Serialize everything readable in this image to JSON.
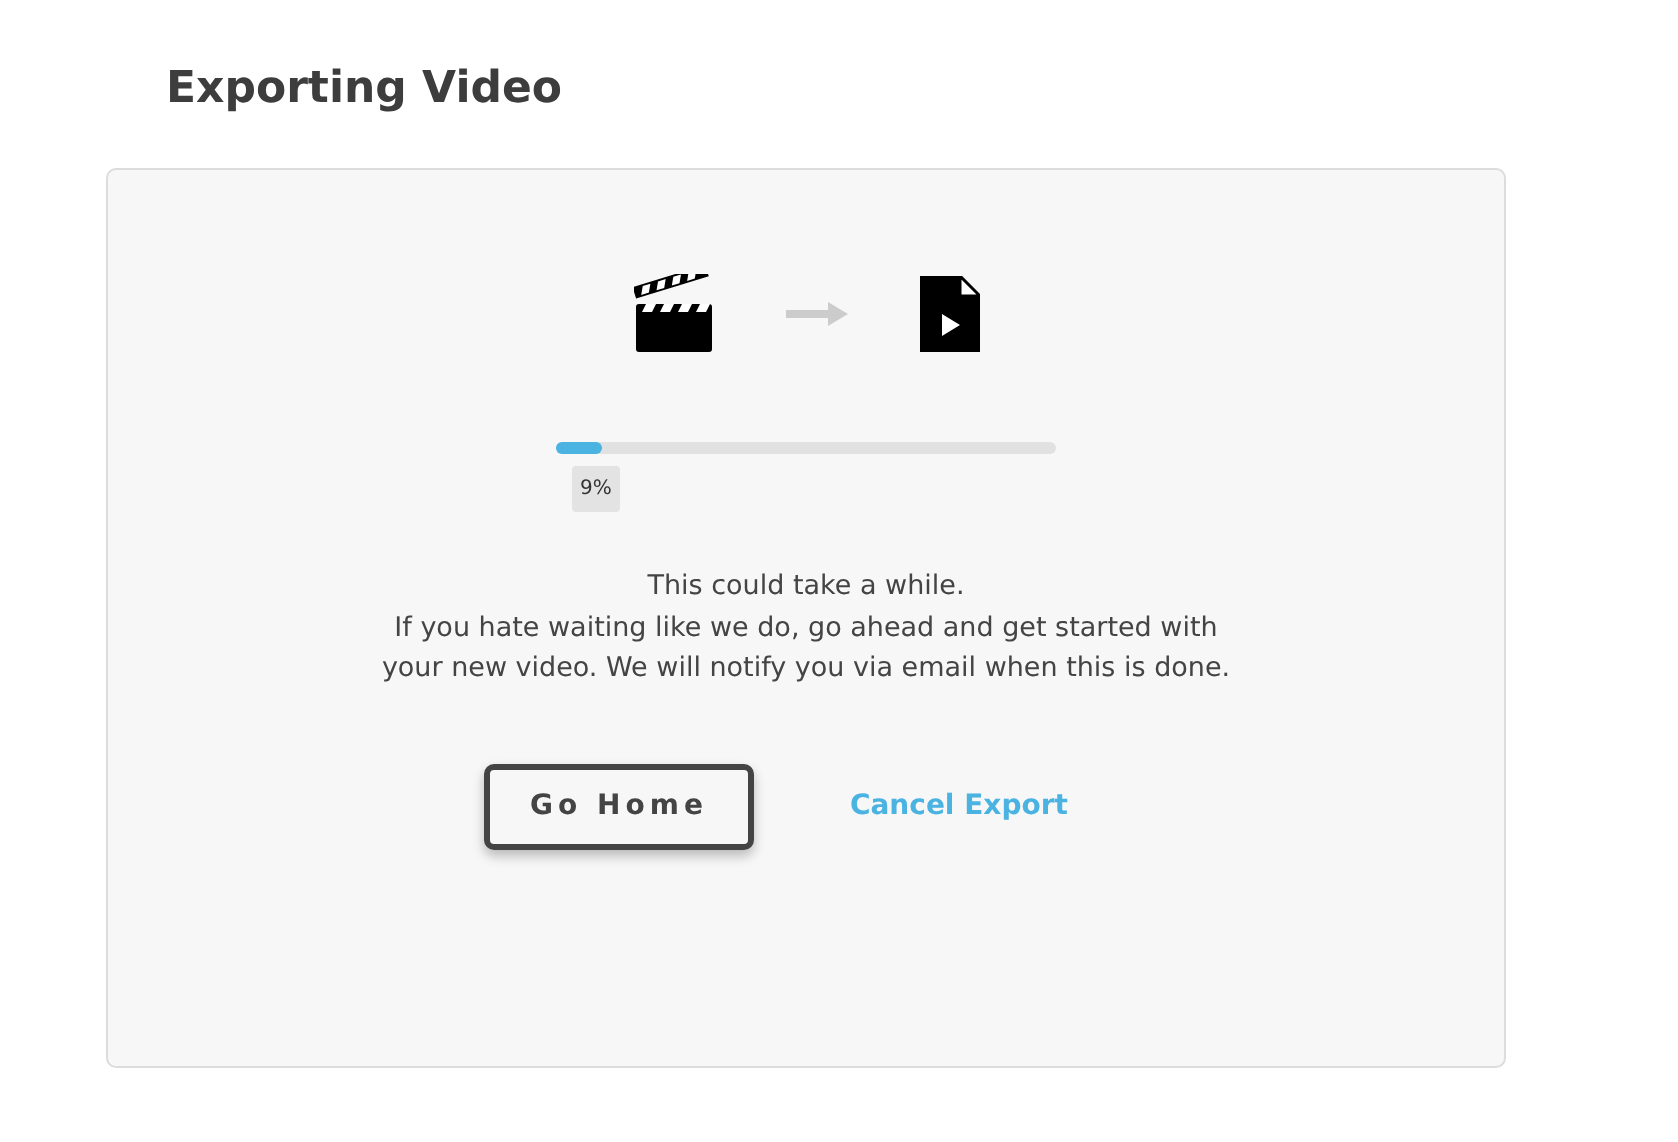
{
  "page": {
    "title": "Exporting Video"
  },
  "export": {
    "level": 0.09,
    "percent": "9%",
    "message_title": "This could take a while.",
    "message_body": "If you hate waiting like we do, go ahead and get started with your new video. We will notify you via email when this is done."
  },
  "actions": [
    {
      "kind": "button",
      "label": "Go Home"
    },
    {
      "kind": "link",
      "label": "Cancel Export"
    }
  ]
}
